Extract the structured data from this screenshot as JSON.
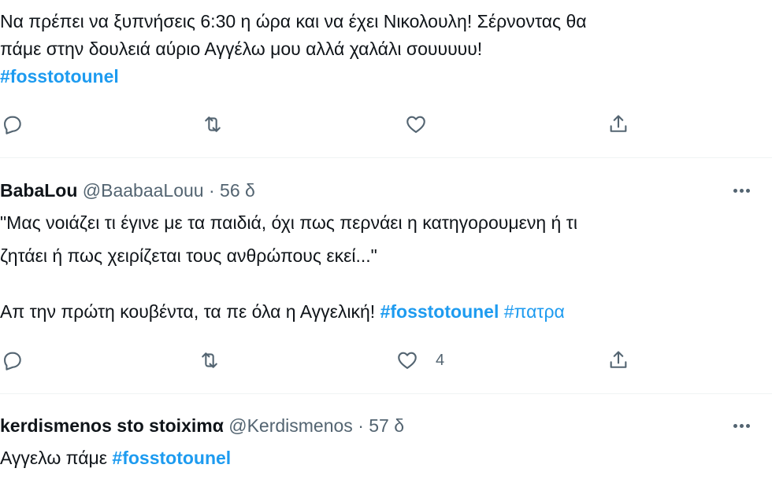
{
  "tweet1": {
    "line1": "Να πρέπει  να ξυπνήσεις 6:30 η ώρα και να έχει Νικολουλη! Σέρνοντας θα",
    "line2": "πάμε στην δουλειά αύριο Αγγέλω μου αλλά χαλάλι σουυυυυ!",
    "hashtag": "#fosstotounel",
    "actions": {
      "reply_icon": "reply-icon",
      "retweet_icon": "retweet-icon",
      "like_icon": "heart-icon",
      "share_icon": "share-icon"
    }
  },
  "tweet2": {
    "name": "BabaLou",
    "handle": "@BaabaaLouu",
    "separator": "·",
    "time": "56 δ",
    "line1": "\"Μας νοιάζει τι έγινε με τα παιδιά, όχι πως περνάει η κατηγορουμενη ή τι",
    "line2": "ζητάει ή πως χειρίζεται τους ανθρώπους εκεί...\"",
    "line3_text": "Απ την πρώτη κουβέντα, τα πε όλα η Αγγελική!",
    "hashtag1": "#fosstotounel",
    "hashtag2": "#πατρα",
    "like_count": "4"
  },
  "tweet3": {
    "name": "kerdismenos sto stoiximα",
    "handle": "@Kerdismenos",
    "separator": "·",
    "time": "57 δ",
    "text": "Αγγελω πάμε",
    "hashtag": "#fosstotounel"
  },
  "colors": {
    "text": "#0f1419",
    "secondary": "#536471",
    "hashtag": "#1d9bf0",
    "divider": "#eff3f4"
  }
}
